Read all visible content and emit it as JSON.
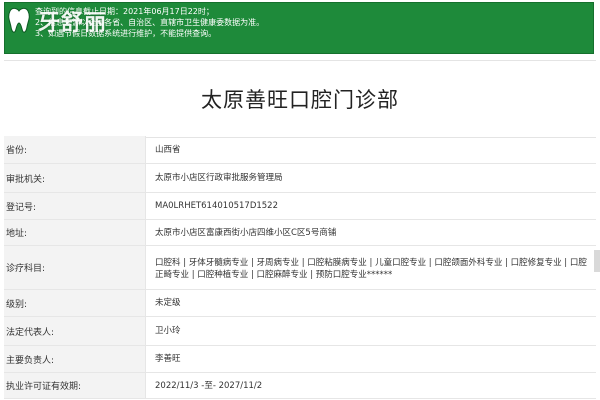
{
  "notice": {
    "line1": "查询到的信息截止日期：2021年06月17日22时；",
    "line2": "2、信息来源以全国各省、自治区、直辖市卫生健康委数据为准。",
    "line3": "3、如遇节假日数据系统进行维护，不能提供查询。"
  },
  "logo": {
    "text": "牙舒丽",
    "icon": "tooth-icon"
  },
  "title": "太原善旺口腔门诊部",
  "rows": [
    {
      "label": "省份:",
      "value": "山西省"
    },
    {
      "label": "审批机关:",
      "value": "太原市小店区行政审批服务管理局"
    },
    {
      "label": "登记号:",
      "value": "MA0LRHET614010517D1522"
    },
    {
      "label": "地址:",
      "value": "太原市小店区富康西街小店四维小区C区5号商铺"
    },
    {
      "label": "诊疗科目:",
      "value": "口腔科 | 牙体牙髓病专业 | 牙周病专业 | 口腔粘膜病专业 | 儿童口腔专业 | 口腔颌面外科专业 | 口腔修复专业 | 口腔正畸专业 | 口腔种植专业 | 口腔麻醉专业 | 预防口腔专业******"
    },
    {
      "label": "级别:",
      "value": "未定级"
    },
    {
      "label": "法定代表人:",
      "value": "卫小玲"
    },
    {
      "label": "主要负责人:",
      "value": "李善旺"
    },
    {
      "label": "执业许可证有效期:",
      "value": "2022/11/3 -至- 2027/11/2"
    }
  ],
  "colors": {
    "banner": "#1e8a3a",
    "label_bg": "#f3f3f3",
    "border": "#e6e6e6"
  }
}
